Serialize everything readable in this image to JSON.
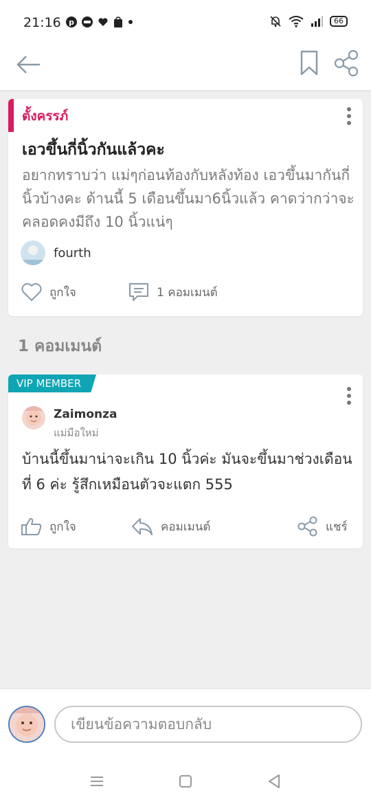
{
  "status": {
    "time": "21:16",
    "battery": "66"
  },
  "post": {
    "tag": "ตั้งครรภ์",
    "title": "เอวขึ้นกี่นิ้วกันแล้วคะ",
    "body": "อยากทราบว่า แม่ๆก่อนท้องกับหลังท้อง เอวขึ้นมากันกี่นิ้วบ้างคะ ด้านนี้ 5 เดือนขึ้นมา6นิ้วแล้ว คาดว่ากว่าจะคลอดคงมีถึง 10 นิ้วแน่ๆ",
    "author": "fourth",
    "like_label": "ถูกใจ",
    "comment_label": "1 คอมเมนต์"
  },
  "comments_section": {
    "title": "1 คอมเมนต์"
  },
  "comment": {
    "badge": "VIP MEMBER",
    "name": "Zaimonza",
    "role": "แม่มือใหม่",
    "text": "บ้านนี้ขึ้นมาน่าจะเกิน 10 นิ้วค่ะ มันจะขึ้นมาช่วงเดือนที่ 6 ค่ะ รู้สึกเหมือนตัวจะแตก 555",
    "like_label": "ถูกใจ",
    "comment_label": "คอมเมนต์",
    "share_label": "แชร์"
  },
  "reply": {
    "placeholder": "เขียนข้อความตอบกลับ"
  },
  "colors": {
    "accent": "#d81b60",
    "vip": "#0fa5b4",
    "icon": "#8a9aa8"
  },
  "icons": [
    "arrow-left-icon",
    "bookmark-icon",
    "share-icon",
    "more-vertical-icon",
    "heart-icon",
    "comment-icon",
    "thumbs-up-icon",
    "reply-icon"
  ]
}
